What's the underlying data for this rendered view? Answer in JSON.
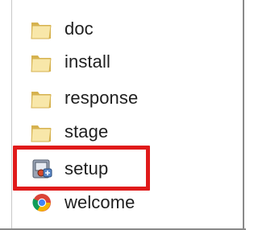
{
  "explorer": {
    "items": [
      {
        "label": "doc",
        "icon": "folder-icon"
      },
      {
        "label": "install",
        "icon": "folder-icon"
      },
      {
        "label": "response",
        "icon": "folder-icon"
      },
      {
        "label": "stage",
        "icon": "folder-icon"
      },
      {
        "label": "setup",
        "icon": "setup-icon"
      },
      {
        "label": "welcome",
        "icon": "chrome-icon"
      }
    ],
    "highlight": {
      "target": "setup",
      "color": "#e01a1a"
    },
    "colors": {
      "folder_light": "#f8e7a9",
      "folder_dark": "#d6b24f",
      "text": "#1f1f1f"
    }
  }
}
